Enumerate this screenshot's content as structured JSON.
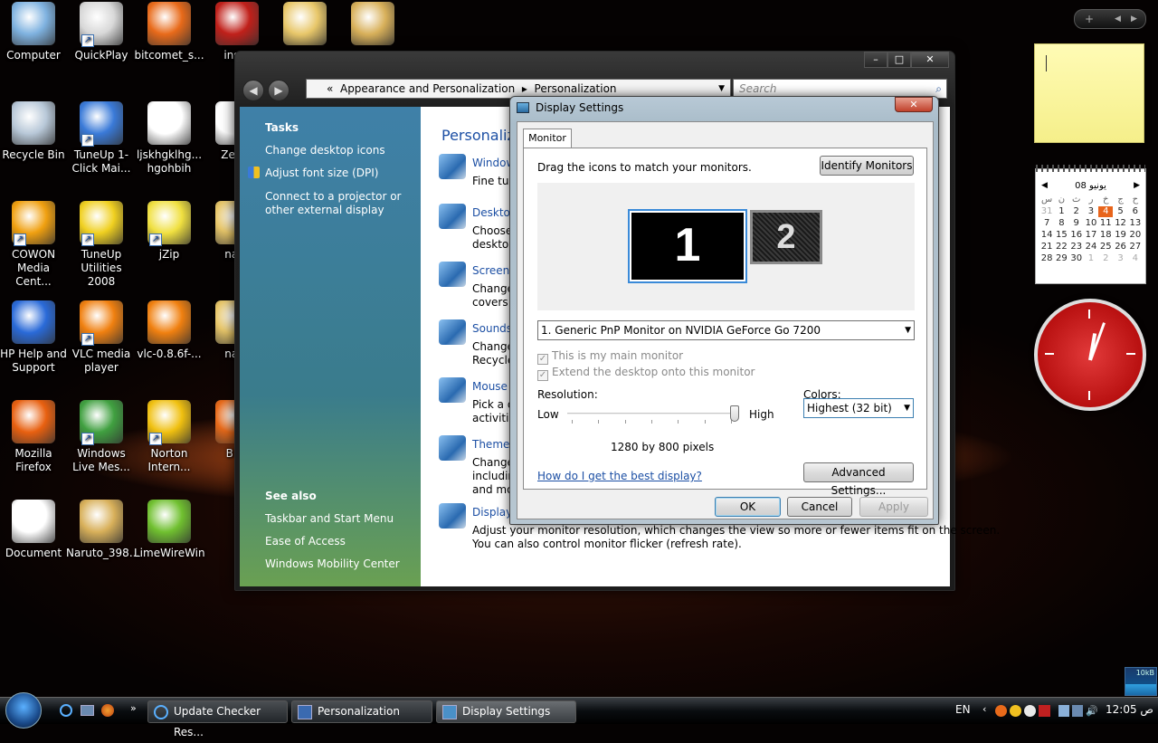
{
  "desktop_icons": [
    {
      "label": "Computer",
      "icon": "computer-icon",
      "color": "#7fb2e0",
      "shortcut": false
    },
    {
      "label": "QuickPlay",
      "icon": "quickplay-icon",
      "color": "#d8d8d8",
      "shortcut": true
    },
    {
      "label": "bitcomet_s...",
      "icon": "bitcomet-icon",
      "color": "#e86a1a",
      "shortcut": false
    },
    {
      "label": "insta",
      "icon": "flash-installer-icon",
      "color": "#c0201a",
      "shortcut": false
    },
    {
      "label": "",
      "icon": "folder-icon",
      "color": "#e8c76a",
      "shortcut": false
    },
    {
      "label": "",
      "icon": "folder-naruto-icon",
      "color": "#d8b05a",
      "shortcut": false
    },
    {
      "label": "Recycle Bin",
      "icon": "recycle-bin-icon",
      "color": "#b8c8d8",
      "shortcut": false
    },
    {
      "label": "TuneUp 1-Click Mai...",
      "icon": "tuneup-icon",
      "color": "#3a7ad8",
      "shortcut": true
    },
    {
      "label": "ljskhgklhg... hgohbih",
      "icon": "document-icon",
      "color": "#ffffff",
      "shortcut": false
    },
    {
      "label": "Zee-Z",
      "icon": "file-icon",
      "color": "#ffffff",
      "shortcut": false
    },
    {
      "label": "COWON Media Cent...",
      "icon": "cowon-icon",
      "color": "#f0a010",
      "shortcut": true
    },
    {
      "label": "TuneUp Utilities 2008",
      "icon": "tuneup-utilities-icon",
      "color": "#f0d020",
      "shortcut": true
    },
    {
      "label": "jZip",
      "icon": "jzip-icon",
      "color": "#f0e040",
      "shortcut": true
    },
    {
      "label": "naru",
      "icon": "folder-icon",
      "color": "#e8c76a",
      "shortcut": false
    },
    {
      "label": "HP Help and Support",
      "icon": "help-icon",
      "color": "#2a6ad8",
      "shortcut": false
    },
    {
      "label": "VLC media player",
      "icon": "vlc-icon",
      "color": "#f08010",
      "shortcut": true
    },
    {
      "label": "vlc-0.8.6f-...",
      "icon": "vlc-installer-icon",
      "color": "#f08010",
      "shortcut": false
    },
    {
      "label": "naru",
      "icon": "folder-icon",
      "color": "#e8c76a",
      "shortcut": false
    },
    {
      "label": "Mozilla Firefox",
      "icon": "firefox-icon",
      "color": "#e86010",
      "shortcut": false
    },
    {
      "label": "Windows Live Mes...",
      "icon": "messenger-icon",
      "color": "#40a040",
      "shortcut": true
    },
    {
      "label": "Norton Intern...",
      "icon": "norton-icon",
      "color": "#f0c010",
      "shortcut": true
    },
    {
      "label": "BitC",
      "icon": "bitcomet-icon",
      "color": "#e86a1a",
      "shortcut": false
    },
    {
      "label": "Document",
      "icon": "document-icon",
      "color": "#ffffff",
      "shortcut": false
    },
    {
      "label": "Naruto_398...",
      "icon": "folder-naruto-icon",
      "color": "#d8b05a",
      "shortcut": false
    },
    {
      "label": "LimeWireWin",
      "icon": "limewire-icon",
      "color": "#70c030",
      "shortcut": false
    }
  ],
  "personalization": {
    "address": {
      "root": "«",
      "crumb1": "Appearance and Personalization",
      "sep": "▸",
      "crumb2": "Personalization"
    },
    "search_placeholder": "Search",
    "tasks_title": "Tasks",
    "tasks": [
      "Change desktop icons",
      "Adjust font size (DPI)",
      "Connect to a projector or other external display"
    ],
    "see_also_title": "See also",
    "see_also": [
      "Taskbar and Start Menu",
      "Ease of Access",
      "Windows Mobility Center"
    ],
    "heading": "Personalize",
    "items": [
      {
        "title": "Window",
        "desc": "Fine tun",
        "icon": "window-color-icon"
      },
      {
        "title": "Desktop",
        "desc": "Choose\ndesktop",
        "icon": "desktop-background-icon"
      },
      {
        "title": "Screen",
        "desc": "Change\ncovers y",
        "icon": "screensaver-icon"
      },
      {
        "title": "Sounds",
        "desc": "Change\nRecycle",
        "icon": "sounds-icon"
      },
      {
        "title": "Mouse",
        "desc": "Pick a d\nactivitie",
        "icon": "mouse-pointer-icon"
      },
      {
        "title": "Theme",
        "desc": "Change\nincludin\nand mo",
        "icon": "theme-icon"
      },
      {
        "title": "Display",
        "desc": "Adjust your monitor resolution, which changes the view so more or fewer items fit on the screen.\nYou can also control monitor flicker (refresh rate).",
        "icon": "display-settings-icon"
      }
    ]
  },
  "dialog": {
    "title": "Display Settings",
    "tab": "Monitor",
    "instruction": "Drag the icons to match your monitors.",
    "identify": "Identify Monitors",
    "mon1": "1",
    "mon2": "2",
    "monitor_select": "1. Generic PnP Monitor on NVIDIA GeForce Go 7200",
    "main_monitor": "This is my main monitor",
    "extend": "Extend the desktop onto this monitor",
    "resolution_label": "Resolution:",
    "low": "Low",
    "high": "High",
    "resolution_slider_fraction": 1.0,
    "resolution_value": "1280 by 800 pixels",
    "colors_label": "Colors:",
    "colors_value": "Highest (32 bit)",
    "help_link": "How do I get the best display?",
    "advanced": "Advanced Settings...",
    "ok": "OK",
    "cancel": "Cancel",
    "apply": "Apply"
  },
  "taskbar": {
    "items": [
      {
        "label": "Update Checker Res...",
        "icon": "ie-icon",
        "active": false
      },
      {
        "label": "Personalization",
        "icon": "personalization-icon",
        "active": false
      },
      {
        "label": "Display Settings",
        "icon": "display-settings-icon",
        "active": true
      }
    ],
    "language": "EN",
    "time": "12:05 ص",
    "net_meter": "10kB"
  },
  "calendar": {
    "month": "يونيو 08",
    "days_header": [
      "س",
      "ن",
      "ث",
      "ر",
      "خ",
      "ج",
      "ح"
    ],
    "cells": [
      "31",
      "1",
      "2",
      "3",
      "4",
      "5",
      "6",
      "7",
      "8",
      "9",
      "10",
      "11",
      "12",
      "13",
      "14",
      "15",
      "16",
      "17",
      "18",
      "19",
      "20",
      "21",
      "22",
      "23",
      "24",
      "25",
      "26",
      "27",
      "28",
      "29",
      "30",
      "1",
      "2",
      "3",
      "4"
    ],
    "today": "4"
  },
  "colors": {
    "accent": "#1c4fa4",
    "today": "#e8641a"
  }
}
